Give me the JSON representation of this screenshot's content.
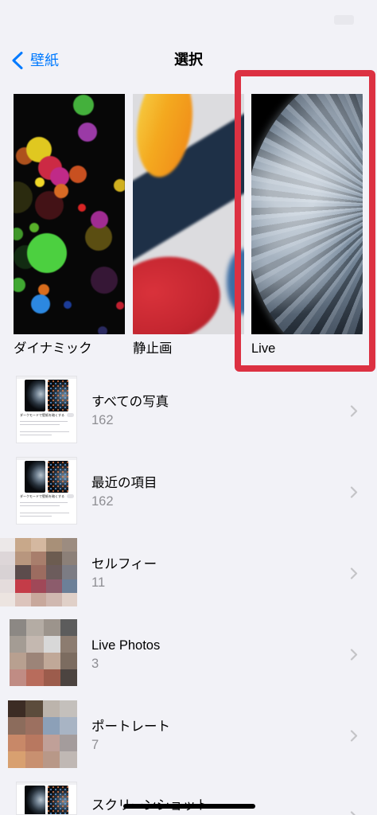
{
  "nav": {
    "back_label": "壁紙",
    "title": "選択"
  },
  "categories": [
    {
      "label": "ダイナミック"
    },
    {
      "label": "静止画"
    },
    {
      "label": "Live"
    }
  ],
  "albums": [
    {
      "title": "すべての写真",
      "count": "162",
      "thumbnail_text": "ダークモードで壁紙を暗くする"
    },
    {
      "title": "最近の項目",
      "count": "162",
      "thumbnail_text": "ダークモードで壁紙を暗くする"
    },
    {
      "title": "セルフィー",
      "count": "11"
    },
    {
      "title": "Live Photos",
      "count": "3"
    },
    {
      "title": "ポートレート",
      "count": "7"
    },
    {
      "title": "スクリーンショット"
    }
  ],
  "icons": {
    "back": "chevron-left-icon",
    "disclosure": "chevron-right-icon"
  },
  "colors": {
    "accent": "#007aff",
    "background": "#f2f2f7",
    "highlight": "#dc3142",
    "secondary_text": "#8e8e93",
    "chevron": "#c4c4c7",
    "label": "#000000"
  }
}
